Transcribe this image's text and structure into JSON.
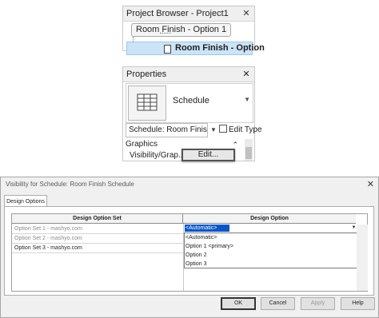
{
  "project_browser": {
    "title": "Project Browser - Project1",
    "close": "✕",
    "tooltip": "Room Finish - Option 1",
    "selected_item": "Room Finish - Option"
  },
  "properties": {
    "title": "Properties",
    "close": "✕",
    "type_name": "Schedule",
    "instance_selector": "Schedule: Room Finis",
    "edit_type_label": "Edit Type",
    "group_label": "Graphics",
    "param_label": "Visibility/Grap...",
    "edit_button": "Edit..."
  },
  "dialog": {
    "title": "Visibility for Schedule: Room Finish Schedule",
    "close": "✕",
    "tab": "Design Options",
    "col_headers": [
      "Design Option Set",
      "Design Option"
    ],
    "rows": [
      {
        "set": "Option Set 1 - mashyo.com"
      },
      {
        "set": "Option Set 2 - mashyo.com"
      },
      {
        "set": "Option Set 3 - mashyo.com"
      }
    ],
    "current_value": "<Automatic>",
    "dropdown_options": [
      "<Automatic>",
      "Option 1  <primary>",
      "Option 2",
      "Option 3"
    ],
    "buttons": {
      "ok": "OK",
      "cancel": "Cancel",
      "apply": "Apply",
      "help": "Help"
    }
  }
}
